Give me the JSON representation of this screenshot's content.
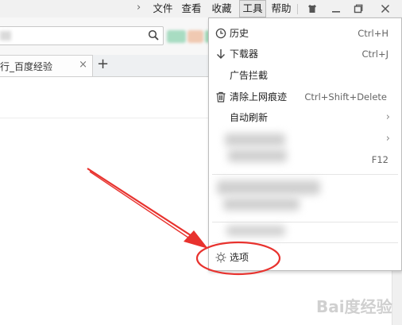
{
  "menubar": {
    "items": [
      {
        "label": "文件"
      },
      {
        "label": "查看"
      },
      {
        "label": "收藏"
      },
      {
        "label": "工具",
        "active": true
      },
      {
        "label": "帮助"
      }
    ],
    "window_buttons": [
      "skin-icon",
      "minimize-icon",
      "restore-icon",
      "close-icon"
    ]
  },
  "tab": {
    "title": "行_百度经验",
    "close": "×",
    "new_tab": "+"
  },
  "tools_menu": {
    "items": [
      {
        "label": "历史",
        "shortcut": "Ctrl+H",
        "icon": "clock-icon"
      },
      {
        "label": "下载器",
        "shortcut": "Ctrl+J",
        "icon": "download-arrow-icon"
      },
      {
        "label": "广告拦截",
        "shortcut": "",
        "icon": ""
      },
      {
        "label": "清除上网痕迹",
        "shortcut": "Ctrl+Shift+Delete",
        "icon": "trash-icon"
      },
      {
        "label": "自动刷新",
        "shortcut": "",
        "icon": "",
        "submenu": true
      },
      {
        "label": "",
        "shortcut": "",
        "icon": "",
        "submenu": true,
        "blurred": true
      },
      {
        "label": "",
        "shortcut": "F12",
        "icon": "",
        "blurred": true
      },
      {
        "label": "选项",
        "shortcut": "",
        "icon": "sun-gear-icon",
        "highlighted": true
      }
    ]
  },
  "annotation": {
    "arrow_color": "#e8322e",
    "ellipse_color": "#e8322e"
  },
  "watermark": {
    "text": "Bai度经验"
  },
  "colors": {
    "menubar_bg": "#f1f1f1",
    "dropdown_border": "#bdbdbd",
    "annotation_red": "#e8322e"
  }
}
